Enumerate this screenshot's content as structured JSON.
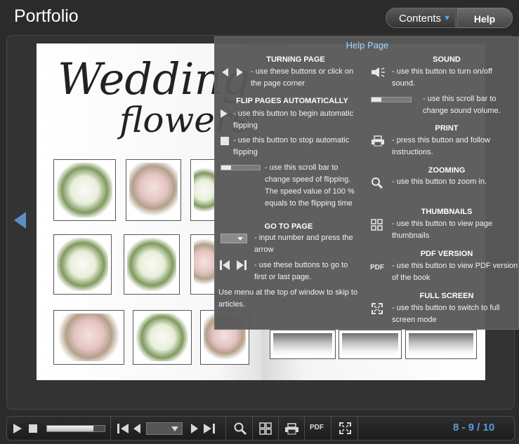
{
  "header": {
    "title": "Portfolio",
    "contents_label": "Contents",
    "help_label": "Help"
  },
  "book": {
    "heading_line1": "Wedding",
    "heading_line2": "flowers"
  },
  "help_panel": {
    "title": "Help Page",
    "left": {
      "turning_page": {
        "heading": "TURNING PAGE",
        "text": "- use these buttons or click on the page corner"
      },
      "flip_auto": {
        "heading": "FLIP PAGES AUTOMATICALLY",
        "begin_text": "- use this button to begin automatic flipping",
        "stop_text": "- use this button to stop automatic flipping",
        "speed_text": "- use this scroll bar to change speed of flipping. The speed value of 100 % equals to the flipping time"
      },
      "goto": {
        "heading": "GO TO PAGE",
        "input_text": "- input number and press the arrow",
        "firstlast_text": "- use these buttons to go to first or last page."
      },
      "menu_text": "Use menu at the top of window to skip to articles."
    },
    "right": {
      "sound": {
        "heading": "SOUND",
        "toggle_text": "- use this button to turn on/off sound.",
        "volume_text": "- use this scroll bar to change sound volume."
      },
      "print": {
        "heading": "PRINT",
        "text": "- press this button and follow instructions."
      },
      "zoom": {
        "heading": "ZOOMING",
        "text": "- use this button to zoom in."
      },
      "thumbs": {
        "heading": "THUMBNAILS",
        "text": "- use this button to view page thumbnails"
      },
      "pdf": {
        "heading": "PDF VERSION",
        "icon_label": "PDF",
        "text": "- use this button to view PDF version of the book"
      },
      "fullscreen": {
        "heading": "FULL SCREEN",
        "text": "- use this button to switch to full screen mode"
      }
    }
  },
  "toolbar": {
    "pdf_label": "PDF",
    "page_indicator": "8 - 9 / 10",
    "flip_speed_level": 0.8
  },
  "colors": {
    "accent_blue": "#5d9ad8",
    "help_title": "#9fd8ff"
  }
}
